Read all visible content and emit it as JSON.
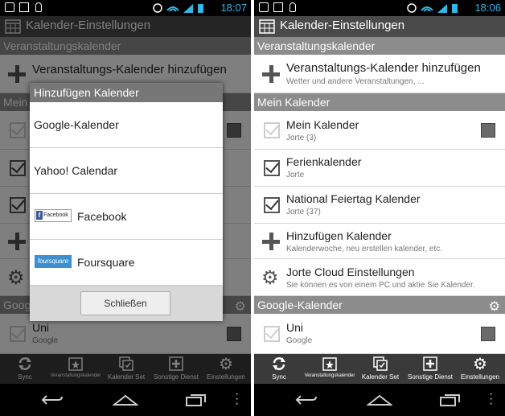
{
  "left": {
    "status_time": "18:07",
    "title": "Kalender-Einstellungen",
    "section_events": "Veranstaltungskalender",
    "add_event_cal_label": "Veranstaltungs-Kalender hinzufügen",
    "section_mine_fragment": "Mein",
    "section_google_fragment": "Googl",
    "row_uni": {
      "main": "Uni",
      "sub": "Google"
    },
    "dialog": {
      "title": "Hinzufügen Kalender",
      "items": [
        {
          "label": "Google-Kalender"
        },
        {
          "label": "Yahoo! Calendar"
        },
        {
          "label": "Facebook",
          "logo": "Facebook"
        },
        {
          "label": "Foursquare",
          "logo": "foursquare"
        }
      ],
      "close_label": "Schließen"
    },
    "nav": [
      {
        "label": "Sync",
        "icon": "sync-icon"
      },
      {
        "label": "Veranstaltungskalender",
        "icon": "star-calendar-icon"
      },
      {
        "label": "Kalender Set",
        "icon": "calendar-set-icon"
      },
      {
        "label": "Sonstige Dienst",
        "icon": "plus-box-icon"
      },
      {
        "label": "Einstellungen",
        "icon": "gear-icon"
      }
    ]
  },
  "right": {
    "status_time": "18:06",
    "title": "Kalender-Einstellungen",
    "section_events": "Veranstaltungskalender",
    "add_event_cal": {
      "main": "Veranstaltungs-Kalender hinzufügen",
      "sub": "Wetter und andere Veranstaltungen, ..."
    },
    "section_mine": "Mein Kalender",
    "rows": [
      {
        "main": "Mein Kalender",
        "sub": "Jorte (3)",
        "checked": false,
        "disabled": true,
        "swatch": true
      },
      {
        "main": "Ferienkalender",
        "sub": "Jorte",
        "checked": true,
        "disabled": false,
        "swatch": false
      },
      {
        "main": "National Feiertag Kalender",
        "sub": "Jorte (37)",
        "checked": true,
        "disabled": false,
        "swatch": false
      }
    ],
    "add_cal": {
      "main": "Hinzufügen Kalender",
      "sub": "Kalenderwoche, neu erstellen kalender, etc."
    },
    "cloud": {
      "main": "Jorte Cloud Einstellungen",
      "sub": "Sie können es von einem PC und aktie Sie Kalender."
    },
    "section_google": "Google-Kalender",
    "row_uni": {
      "main": "Uni",
      "sub": "Google"
    },
    "nav": [
      {
        "label": "Sync",
        "icon": "sync-icon"
      },
      {
        "label": "Veranstaltungskalender",
        "icon": "star-calendar-icon"
      },
      {
        "label": "Kalender Set",
        "icon": "calendar-set-icon"
      },
      {
        "label": "Sonstige Dienst",
        "icon": "plus-box-icon"
      },
      {
        "label": "Einstellungen",
        "icon": "gear-icon"
      }
    ]
  },
  "colors": {
    "accent_time": "#33b5e5",
    "section_bg": "#8c8c8c",
    "titlebar_bg": "#4a4a4a"
  }
}
